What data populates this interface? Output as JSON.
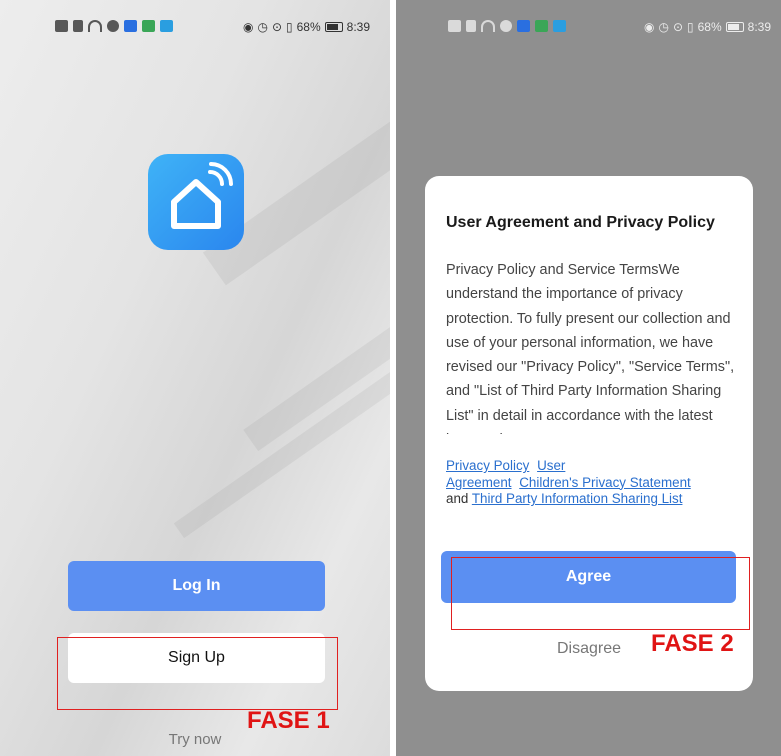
{
  "left_screen": {
    "status_bar": {
      "battery": "68%",
      "time": "8:39"
    },
    "login_label": "Log In",
    "signup_label": "Sign Up",
    "try_now_label": "Try now"
  },
  "right_screen": {
    "status_bar": {
      "battery": "68%",
      "time": "8:39"
    },
    "dialog": {
      "title": "User Agreement and Privacy Policy",
      "body": "Privacy Policy and Service TermsWe understand the importance of privacy protection. To fully present our collection and use of your personal information, we have revised our \"Privacy Policy\", \"Service Terms\", and \"List of Third Party Information Sharing List\" in detail in accordance with the latest laws and",
      "links": {
        "privacy_policy": "Privacy Policy",
        "user_agreement_1": "User",
        "user_agreement_2": "Agreement",
        "children_privacy": "Children's Privacy Statement",
        "and_text": "and",
        "third_party": "Third Party Information Sharing List"
      },
      "agree_label": "Agree",
      "disagree_label": "Disagree"
    }
  },
  "annotations": {
    "fase1": "FASE 1",
    "fase2": "FASE 2",
    "highlight_color": "#e02020"
  },
  "colors": {
    "primary_button": "#5b8ff2",
    "logo_gradient_start": "#3fb3f7",
    "logo_gradient_end": "#2a86ee",
    "link": "#2a6fce"
  }
}
